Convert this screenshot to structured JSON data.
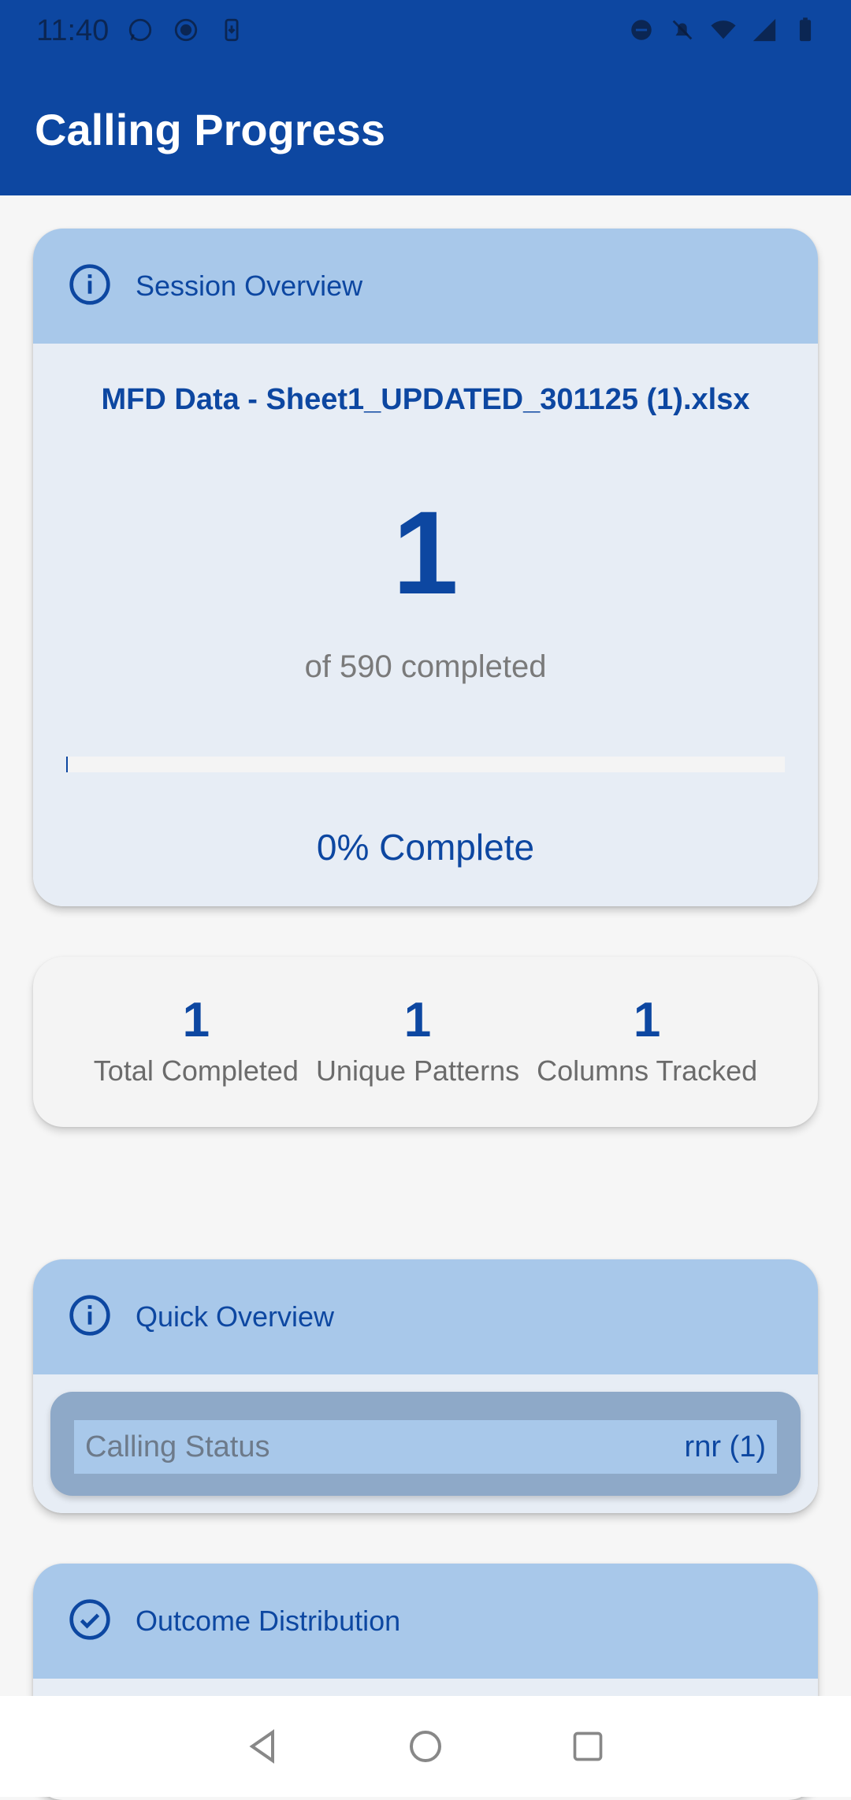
{
  "status_bar": {
    "time": "11:40",
    "left_icons": [
      "whatsapp-icon",
      "record-icon",
      "download-icon"
    ],
    "right_icons": [
      "dnd-icon",
      "bell-off-icon",
      "wifi-icon",
      "signal-icon",
      "battery-icon"
    ]
  },
  "app_bar": {
    "title": "Calling Progress"
  },
  "session_overview": {
    "header": "Session Overview",
    "header_icon": "info-icon",
    "file_name": "MFD Data - Sheet1_UPDATED_301125 (1).xlsx",
    "completed_count": "1",
    "of_text": "of 590 completed",
    "progress_fraction": 0.0017,
    "percent_text": "0% Complete"
  },
  "stats": [
    {
      "value": "1",
      "label": "Total Completed"
    },
    {
      "value": "1",
      "label": "Unique Patterns"
    },
    {
      "value": "1",
      "label": "Columns Tracked"
    }
  ],
  "quick_overview": {
    "header": "Quick Overview",
    "header_icon": "info-icon",
    "row_label": "Calling Status",
    "row_value": "rnr (1)"
  },
  "outcome_distribution": {
    "header": "Outcome Distribution",
    "header_icon": "check-circle-icon"
  },
  "nav": [
    "back-icon",
    "home-icon",
    "recents-icon"
  ],
  "colors": {
    "primary": "#0d47a1",
    "header_tint": "#a8c8ea",
    "card_body": "#e7edf5"
  }
}
